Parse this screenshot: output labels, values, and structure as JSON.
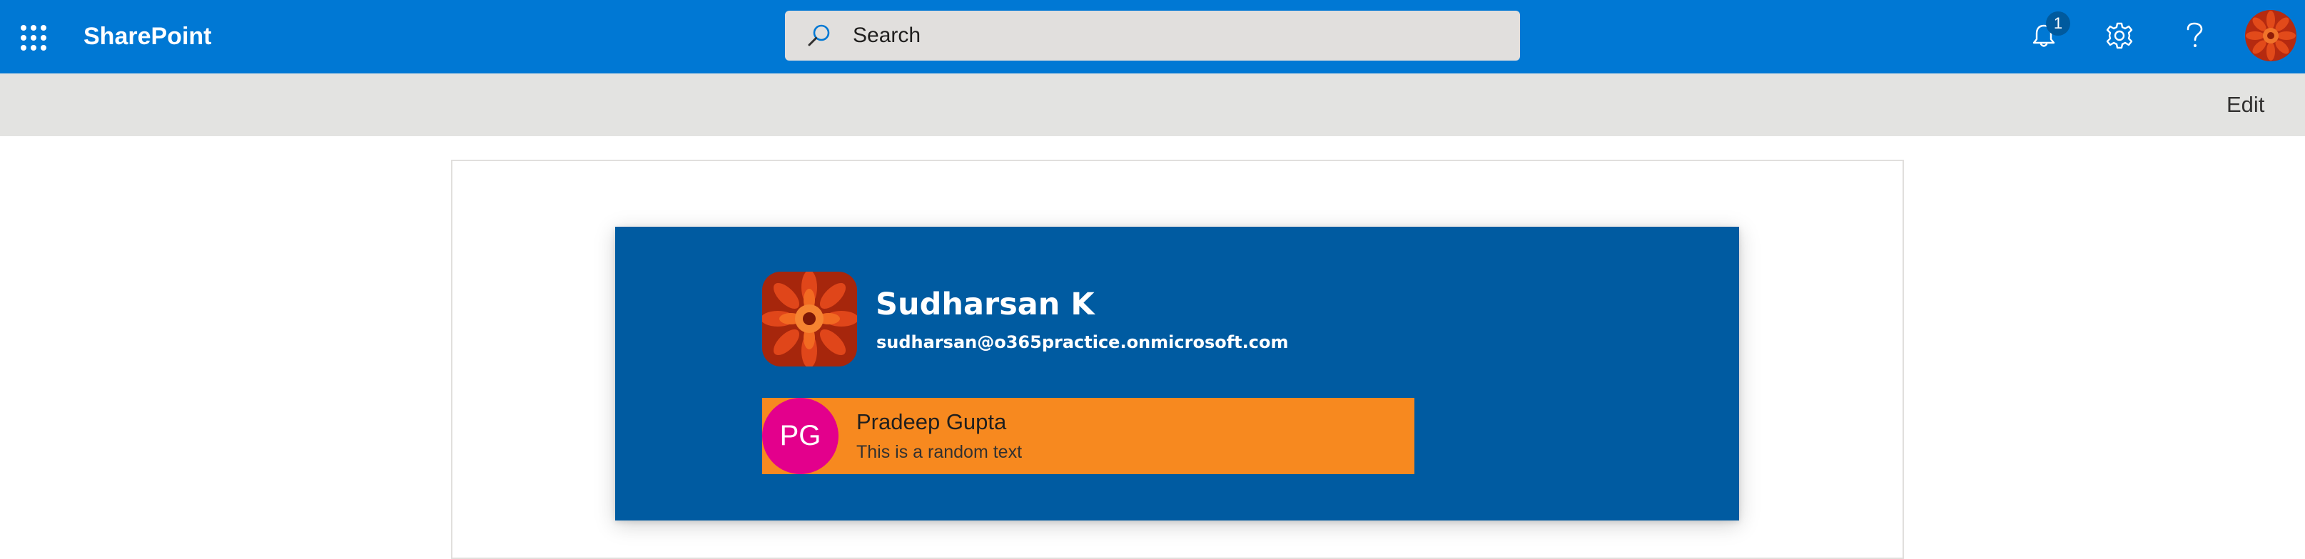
{
  "suite_bar": {
    "app_name": "SharePoint",
    "search_placeholder": "Search",
    "notification_count": "1",
    "icons": {
      "waffle": "app-launcher-icon",
      "bell": "bell-icon",
      "gear": "gear-icon",
      "help": "help-icon",
      "avatar": "avatar"
    },
    "colors": {
      "bar": "#0078d4",
      "search": "#e1dfdd",
      "badge": "#005a9e"
    }
  },
  "command_bar": {
    "edit_label": "Edit"
  },
  "profile_card": {
    "name": "Sudharsan K",
    "email": "sudharsan@o365practice.onmicrosoft.com",
    "background_color": "#005ba1"
  },
  "persona": {
    "initials": "PG",
    "name": "Pradeep Gupta",
    "secondary_text": "This is a random text",
    "card_color": "#f7891f",
    "initials_color": "#e3008c"
  }
}
